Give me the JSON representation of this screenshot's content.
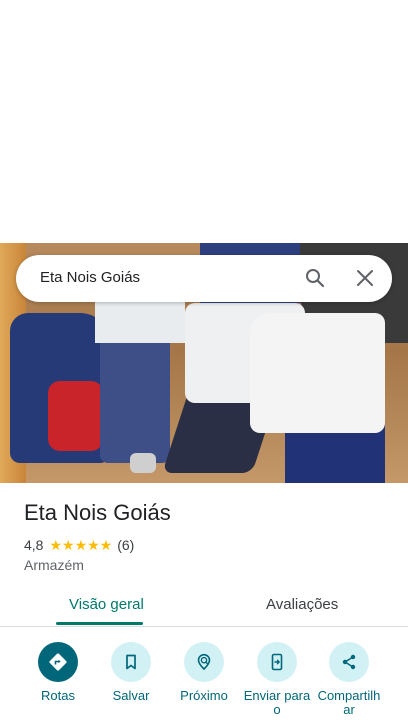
{
  "search": {
    "query": "Eta Nois Goiás"
  },
  "place": {
    "title": "Eta Nois Goiás",
    "rating": "4,8",
    "rating_value": 4.8,
    "stars": "★★★★★",
    "review_count": "(6)",
    "category": "Armazém"
  },
  "tabs": [
    {
      "label": "Visão geral",
      "selected": true
    },
    {
      "label": "Avaliações",
      "selected": false
    }
  ],
  "actions": [
    {
      "label": "Rotas",
      "icon": "directions-icon"
    },
    {
      "label": "Salvar",
      "icon": "bookmark-icon"
    },
    {
      "label": "Próximo",
      "icon": "nearby-icon"
    },
    {
      "label": "Enviar para o",
      "icon": "send-to-phone-icon"
    },
    {
      "label": "Compartilhar",
      "icon": "share-icon"
    }
  ],
  "colors": {
    "accent": "#00796b",
    "action_fill": "#d2f1f5",
    "primary_action": "#00677a",
    "star": "#fbbc04"
  }
}
